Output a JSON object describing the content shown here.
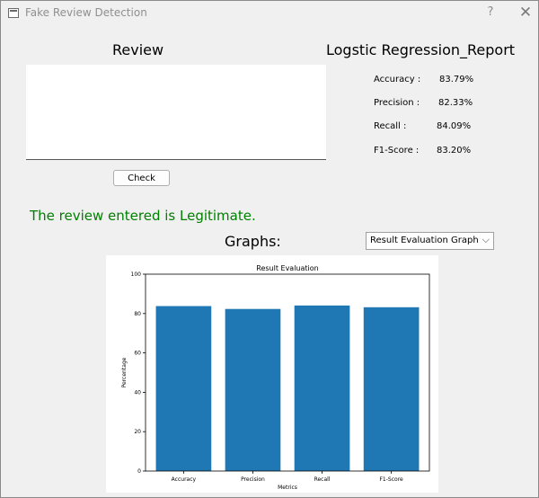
{
  "window": {
    "title": "Fake Review Detection",
    "help": "?",
    "close": "✕"
  },
  "review": {
    "heading": "Review",
    "text": ""
  },
  "check_button": "Check",
  "report": {
    "heading": "Logstic Regression_Report",
    "metrics": [
      {
        "label": "Accuracy :",
        "value": "83.79%"
      },
      {
        "label": "Precision :",
        "value": "82.33%"
      },
      {
        "label": "Recall :",
        "value": "84.09%"
      },
      {
        "label": "F1-Score :",
        "value": "83.20%"
      }
    ]
  },
  "result_message": "The review entered is Legitimate.",
  "result_color": "#008000",
  "graphs": {
    "label": "Graphs:",
    "selected": "Result Evaluation Graph"
  },
  "chart_data": {
    "type": "bar",
    "title": "Result Evaluation",
    "xlabel": "Metrics",
    "ylabel": "Percentage",
    "categories": [
      "Accuracy",
      "Precision",
      "Recall",
      "F1-Score"
    ],
    "values": [
      83.79,
      82.33,
      84.09,
      83.2
    ],
    "ylim": [
      0,
      100
    ],
    "yticks": [
      "0",
      "20",
      "40",
      "60",
      "80",
      "100"
    ],
    "bar_color": "#1f77b4",
    "grid": false
  }
}
